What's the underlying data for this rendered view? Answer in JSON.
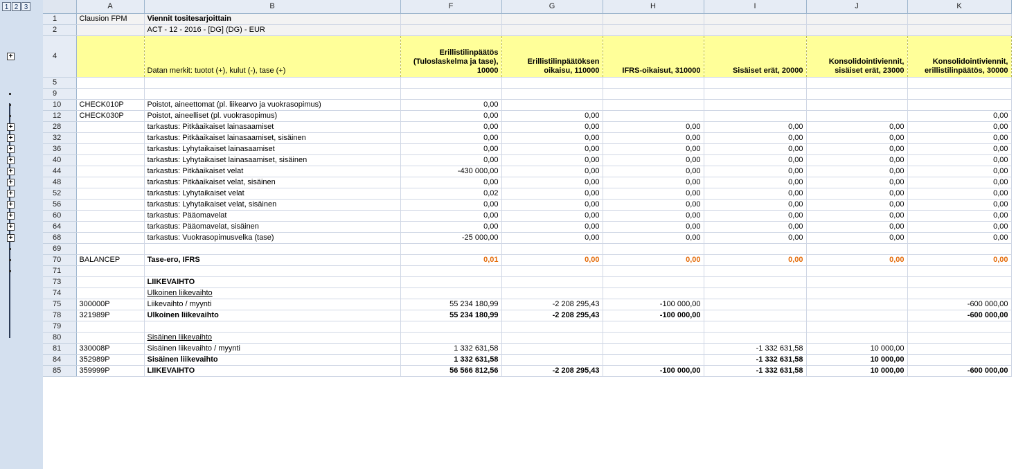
{
  "outline": {
    "levels": [
      "1",
      "2",
      "3"
    ],
    "plus": "+"
  },
  "columns": [
    "A",
    "B",
    "F",
    "G",
    "H",
    "I",
    "J",
    "K"
  ],
  "header_rows": [
    {
      "num": "1",
      "a": "Clausion FPM",
      "b": "Viennit tositesarjoittain"
    },
    {
      "num": "2",
      "a": "",
      "b": "ACT - 12 - 2016 - [DG] (DG) - EUR"
    }
  ],
  "yellow_row": {
    "num": "4",
    "b": "Datan merkit: tuotot (+), kulut (-), tase (+)",
    "f": "Erillistilinpäätös (Tuloslaskelma ja tase), 10000",
    "g": "Erillistilinpäätöksen oikaisu, 110000",
    "h": "IFRS-oikaisut, 310000",
    "i": "Sisäiset erät, 20000",
    "j": "Konsolidointiviennit, sisäiset erät, 23000",
    "k": "Konsolidointiviennit, erillistilinpäätös, 30000"
  },
  "rows": [
    {
      "num": "5",
      "a": "",
      "b": "",
      "f": "",
      "g": "",
      "h": "",
      "i": "",
      "j": "",
      "k": ""
    },
    {
      "num": "9",
      "a": "",
      "b": "",
      "f": "",
      "g": "",
      "h": "",
      "i": "",
      "j": "",
      "k": ""
    },
    {
      "num": "10",
      "a": "CHECK010P",
      "b": "Poistot, aineettomat (pl. liikearvo ja vuokrasopimus)",
      "f": "0,00",
      "g": "",
      "h": "",
      "i": "",
      "j": "",
      "k": ""
    },
    {
      "num": "12",
      "a": "CHECK030P",
      "b": "Poistot, aineelliset (pl. vuokrasopimus)",
      "f": "0,00",
      "g": "0,00",
      "h": "",
      "i": "",
      "j": "",
      "k": "0,00"
    },
    {
      "num": "28",
      "a": "",
      "b": "tarkastus: Pitkäaikaiset lainasaamiset",
      "f": "0,00",
      "g": "0,00",
      "h": "0,00",
      "i": "0,00",
      "j": "0,00",
      "k": "0,00"
    },
    {
      "num": "32",
      "a": "",
      "b": "tarkastus: Pitkäaikaiset lainasaamiset, sisäinen",
      "f": "0,00",
      "g": "0,00",
      "h": "0,00",
      "i": "0,00",
      "j": "0,00",
      "k": "0,00"
    },
    {
      "num": "36",
      "a": "",
      "b": "tarkastus: Lyhytaikaiset lainasaamiset",
      "f": "0,00",
      "g": "0,00",
      "h": "0,00",
      "i": "0,00",
      "j": "0,00",
      "k": "0,00"
    },
    {
      "num": "40",
      "a": "",
      "b": "tarkastus: Lyhytaikaiset lainasaamiset, sisäinen",
      "f": "0,00",
      "g": "0,00",
      "h": "0,00",
      "i": "0,00",
      "j": "0,00",
      "k": "0,00"
    },
    {
      "num": "44",
      "a": "",
      "b": "tarkastus: Pitkäaikaiset velat",
      "f": "-430 000,00",
      "g": "0,00",
      "h": "0,00",
      "i": "0,00",
      "j": "0,00",
      "k": "0,00"
    },
    {
      "num": "48",
      "a": "",
      "b": "tarkastus: Pitkäaikaiset velat, sisäinen",
      "f": "0,00",
      "g": "0,00",
      "h": "0,00",
      "i": "0,00",
      "j": "0,00",
      "k": "0,00"
    },
    {
      "num": "52",
      "a": "",
      "b": "tarkastus: Lyhytaikaiset velat",
      "f": "0,02",
      "g": "0,00",
      "h": "0,00",
      "i": "0,00",
      "j": "0,00",
      "k": "0,00"
    },
    {
      "num": "56",
      "a": "",
      "b": "tarkastus: Lyhytaikaiset velat, sisäinen",
      "f": "0,00",
      "g": "0,00",
      "h": "0,00",
      "i": "0,00",
      "j": "0,00",
      "k": "0,00"
    },
    {
      "num": "60",
      "a": "",
      "b": "tarkastus: Pääomavelat",
      "f": "0,00",
      "g": "0,00",
      "h": "0,00",
      "i": "0,00",
      "j": "0,00",
      "k": "0,00"
    },
    {
      "num": "64",
      "a": "",
      "b": "tarkastus: Pääomavelat, sisäinen",
      "f": "0,00",
      "g": "0,00",
      "h": "0,00",
      "i": "0,00",
      "j": "0,00",
      "k": "0,00"
    },
    {
      "num": "68",
      "a": "",
      "b": "tarkastus: Vuokrasopimusvelka (tase)",
      "f": "-25 000,00",
      "g": "0,00",
      "h": "0,00",
      "i": "0,00",
      "j": "0,00",
      "k": "0,00"
    },
    {
      "num": "69",
      "a": "",
      "b": "",
      "f": "",
      "g": "",
      "h": "",
      "i": "",
      "j": "",
      "k": ""
    },
    {
      "num": "70",
      "a": "BALANCEP",
      "b": "Tase-ero, IFRS",
      "f": "0,01",
      "g": "0,00",
      "h": "0,00",
      "i": "0,00",
      "j": "0,00",
      "k": "0,00"
    },
    {
      "num": "71",
      "a": "",
      "b": "",
      "f": "",
      "g": "",
      "h": "",
      "i": "",
      "j": "",
      "k": ""
    },
    {
      "num": "73",
      "a": "",
      "b": "LIIKEVAIHTO",
      "f": "",
      "g": "",
      "h": "",
      "i": "",
      "j": "",
      "k": ""
    },
    {
      "num": "74",
      "a": "",
      "b": "Ulkoinen liikevaihto",
      "f": "",
      "g": "",
      "h": "",
      "i": "",
      "j": "",
      "k": ""
    },
    {
      "num": "75",
      "a": "300000P",
      "b": "Liikevaihto / myynti",
      "f": "55 234 180,99",
      "g": "-2 208 295,43",
      "h": "-100 000,00",
      "i": "",
      "j": "",
      "k": "-600 000,00"
    },
    {
      "num": "78",
      "a": "321989P",
      "b": "Ulkoinen liikevaihto",
      "f": "55 234 180,99",
      "g": "-2 208 295,43",
      "h": "-100 000,00",
      "i": "",
      "j": "",
      "k": "-600 000,00"
    },
    {
      "num": "79",
      "a": "",
      "b": "",
      "f": "",
      "g": "",
      "h": "",
      "i": "",
      "j": "",
      "k": ""
    },
    {
      "num": "80",
      "a": "",
      "b": "Sisäinen liikevaihto",
      "f": "",
      "g": "",
      "h": "",
      "i": "",
      "j": "",
      "k": ""
    },
    {
      "num": "81",
      "a": "330008P",
      "b": "Sisäinen liikevaihto / myynti",
      "f": "1 332 631,58",
      "g": "",
      "h": "",
      "i": "-1 332 631,58",
      "j": "10 000,00",
      "k": ""
    },
    {
      "num": "84",
      "a": "352989P",
      "b": "Sisäinen liikevaihto",
      "f": "1 332 631,58",
      "g": "",
      "h": "",
      "i": "-1 332 631,58",
      "j": "10 000,00",
      "k": ""
    },
    {
      "num": "85",
      "a": "359999P",
      "b": "LIIKEVAIHTO",
      "f": "56 566 812,56",
      "g": "-2 208 295,43",
      "h": "-100 000,00",
      "i": "-1 332 631,58",
      "j": "10 000,00",
      "k": "-600 000,00"
    }
  ]
}
